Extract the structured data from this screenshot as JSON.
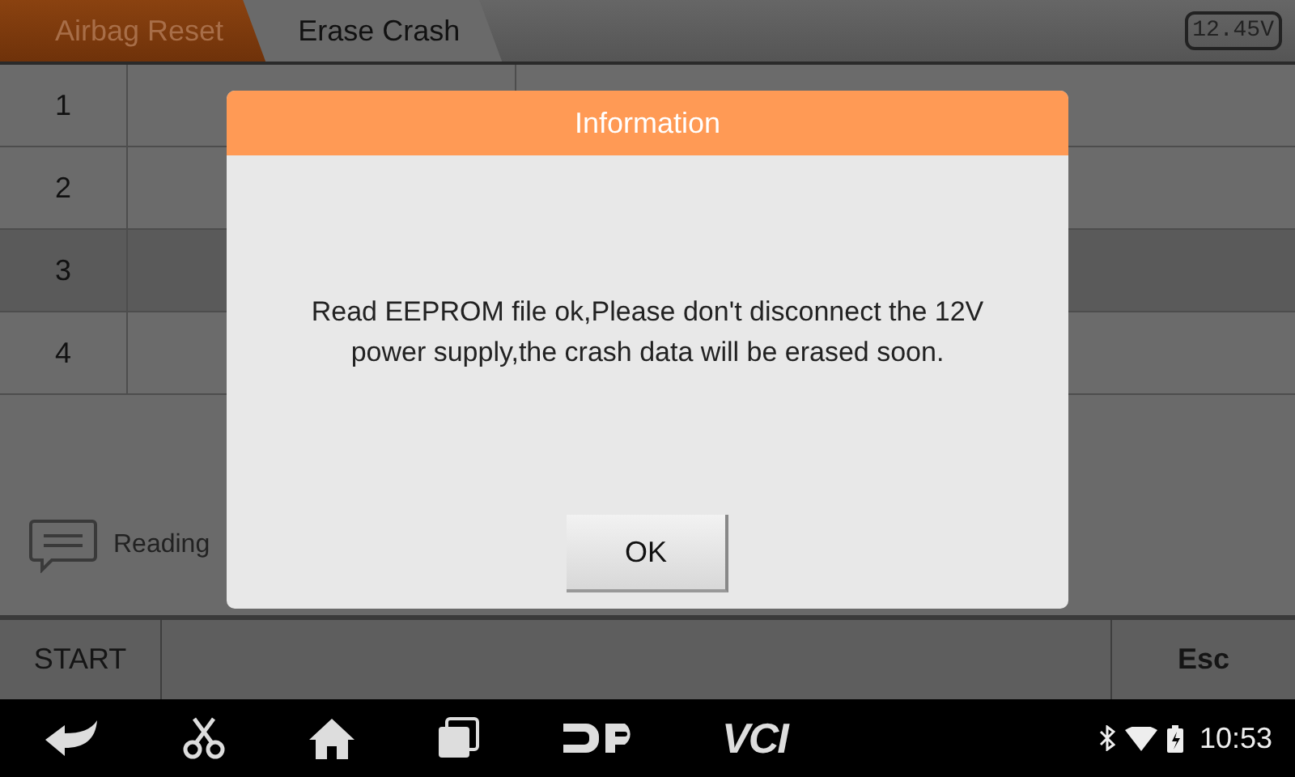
{
  "breadcrumbs": [
    {
      "label": "Airbag Reset",
      "selected": false
    },
    {
      "label": "Erase Crash",
      "selected": true
    }
  ],
  "voltage": "12.45V",
  "table": {
    "rows": [
      {
        "number": "1",
        "selected": false
      },
      {
        "number": "2",
        "selected": false
      },
      {
        "number": "3",
        "selected": true
      },
      {
        "number": "4",
        "selected": false
      }
    ]
  },
  "status_message": "Reading",
  "buttons": {
    "left": "START",
    "right": "Esc"
  },
  "dialog": {
    "title": "Information",
    "message": "Read EEPROM file ok,Please don't disconnect the 12V power supply,the crash data will be erased soon.",
    "button": "OK"
  },
  "nav_bar": {
    "labels": [
      "VCI"
    ],
    "time": "10:53"
  }
}
